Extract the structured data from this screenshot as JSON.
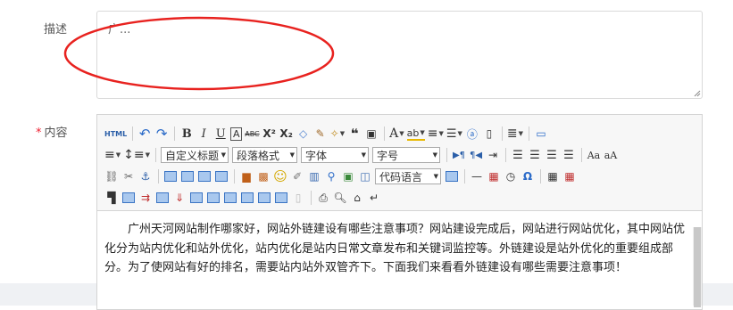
{
  "form": {
    "description_label": "描述",
    "description_value": "广...",
    "content_label": "内容",
    "required_mark": "*"
  },
  "toolbar": {
    "row1": [
      {
        "name": "html-source",
        "label": "HTML"
      },
      {
        "name": "undo",
        "glyph": "↶"
      },
      {
        "name": "redo",
        "glyph": "↷"
      },
      {
        "name": "bold",
        "label": "B"
      },
      {
        "name": "italic",
        "label": "I"
      },
      {
        "name": "underline",
        "label": "U"
      },
      {
        "name": "font-border",
        "label": "A"
      },
      {
        "name": "strikethrough",
        "label": "ABC"
      },
      {
        "name": "superscript",
        "label": "X²"
      },
      {
        "name": "subscript",
        "label": "X₂"
      },
      {
        "name": "eraser",
        "glyph": "◇"
      },
      {
        "name": "format-brush",
        "glyph": "✎"
      },
      {
        "name": "auto-typeset",
        "glyph": "✧"
      },
      {
        "name": "blockquote",
        "glyph": "❝"
      },
      {
        "name": "pasteplain",
        "glyph": "▣"
      },
      {
        "name": "forecolor",
        "label": "A"
      },
      {
        "name": "backcolor",
        "label": "ab"
      },
      {
        "name": "ordered-list",
        "glyph": "≡"
      },
      {
        "name": "unordered-list",
        "glyph": "☰"
      },
      {
        "name": "select-all",
        "glyph": "ⓐ"
      },
      {
        "name": "clear-doc",
        "glyph": "▯"
      },
      {
        "name": "row-spacing-top",
        "glyph": "≣"
      },
      {
        "name": "preview",
        "glyph": "▭"
      }
    ],
    "row2_selects": {
      "custom_title": "自定义标题",
      "paragraph_format": "段落格式",
      "font_family": "字体",
      "font_size": "字号"
    },
    "row3_select": "代码语言"
  },
  "content": {
    "paragraph": "广州天河网站制作哪家好，网站外链建设有哪些注意事项？网站建设完成后，网站进行网站优化，其中网站优化分为站内优化和站外优化，站内优化是站内日常文章发布和关键词监控等。外链建设是站外优化的重要组成部分。为了使网站有好的排名，需要站内站外双管齐下。下面我们来看看外链建设有哪些需要注意事项！"
  },
  "colors": {
    "accent_red": "#e8221f",
    "label": "#555555",
    "required": "#ee2233"
  }
}
